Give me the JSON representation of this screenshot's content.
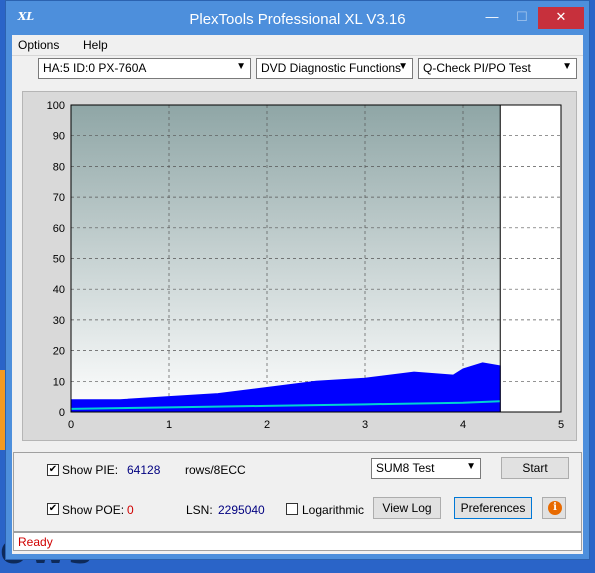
{
  "window": {
    "title": "PlexTools Professional XL V3.16",
    "icon": "XL",
    "min_glyph": "—",
    "max_glyph": "☐",
    "close_glyph": "✕"
  },
  "menu": {
    "options": "Options",
    "help": "Help"
  },
  "toolbar": {
    "drive": "HA:5 ID:0  PX-760A",
    "function": "DVD Diagnostic Functions",
    "test": "Q-Check PI/PO Test"
  },
  "chart_data": {
    "type": "area",
    "xlim": [
      0,
      5
    ],
    "ylim": [
      0,
      100
    ],
    "x_ticks": [
      "0",
      "1",
      "2",
      "3",
      "4",
      "5"
    ],
    "y_ticks": [
      "0",
      "10",
      "20",
      "30",
      "40",
      "50",
      "60",
      "70",
      "80",
      "90",
      "100"
    ],
    "grid": true,
    "end_marker_x": 4.38,
    "series": [
      {
        "color": "#0000ff",
        "x": [
          0,
          0.5,
          1,
          1.5,
          2,
          2.5,
          3,
          3.5,
          3.9,
          4.0,
          4.2,
          4.38
        ],
        "y": [
          4,
          4,
          5,
          6,
          8,
          10,
          11,
          13,
          12,
          14,
          16,
          15
        ]
      },
      {
        "color": "#00d2d2",
        "x": [
          0,
          1,
          2,
          3,
          4,
          4.38
        ],
        "y": [
          1,
          1.5,
          2,
          2.5,
          3,
          3.5
        ]
      }
    ]
  },
  "bottom": {
    "show_pie_label": "Show PIE:",
    "pie_value": "64128",
    "pie_unit": "rows/8ECC",
    "show_poe_label": "Show POE:",
    "poe_value": "0",
    "lsn_label": "LSN:",
    "lsn_value": "2295040",
    "log_label": "Logarithmic",
    "sum_select": "SUM8 Test",
    "start_button": "Start",
    "viewlog_button": "View Log",
    "preferences_button": "Preferences",
    "check_glyph": "✔",
    "info_glyph": "i"
  },
  "status": {
    "text": "Ready"
  },
  "desktop": {
    "text": "ows"
  }
}
